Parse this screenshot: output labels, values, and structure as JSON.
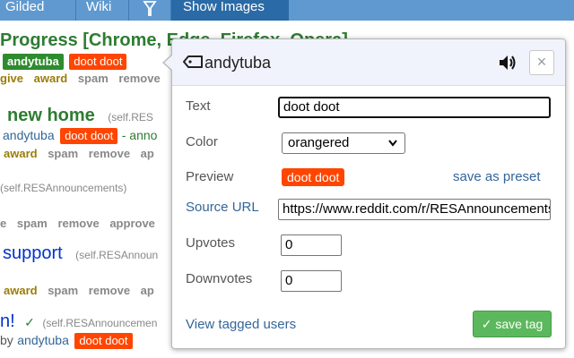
{
  "topbar": {
    "tabs": [
      "Gilded",
      "Wiki",
      "Show Images"
    ]
  },
  "posts": [
    {
      "title": "Progress [Chrome, Edge, Firefox, Opera]",
      "flairs": [
        "andytuba",
        "doot doot"
      ],
      "buttons": [
        "give award",
        "spam",
        "remove"
      ]
    },
    {
      "title": "new home",
      "domain": "(self.RES",
      "author": "andytuba",
      "flair": "doot doot",
      "extra": "- anno",
      "buttons": [
        "award",
        "spam",
        "remove",
        "ap"
      ]
    },
    {
      "domain": "(self.RESAnnouncements)",
      "buttons": [
        "e",
        "spam",
        "remove",
        "approve"
      ]
    },
    {
      "title": "support",
      "domain": "(self.RESAnnoun",
      "buttons": [
        "award",
        "spam",
        "remove",
        "ap"
      ]
    },
    {
      "title": "n!",
      "check": "✓",
      "domain": "(self.RESAnnouncemen",
      "author_prefix": "by",
      "author": "andytuba",
      "flair": "doot doot"
    }
  ],
  "popup": {
    "username": "andytuba",
    "close_label": "×",
    "labels": {
      "text": "Text",
      "color": "Color",
      "preview": "Preview",
      "source_url": "Source URL",
      "upvotes": "Upvotes",
      "downvotes": "Downvotes"
    },
    "text_value": "doot doot",
    "color_value": "orangered",
    "preview_text": "doot doot",
    "save_preset_label": "save as preset",
    "source_url_value": "https://www.reddit.com/r/RESAnnouncements",
    "upvotes_value": "0",
    "downvotes_value": "0",
    "view_tagged_label": "View tagged users",
    "save_tag_label": "✓ save tag"
  },
  "colors": {
    "accent_orangered": "#ff4500",
    "save_green": "#5cb85c",
    "link_blue": "#336699",
    "topbar_blue": "#5f99cf"
  }
}
